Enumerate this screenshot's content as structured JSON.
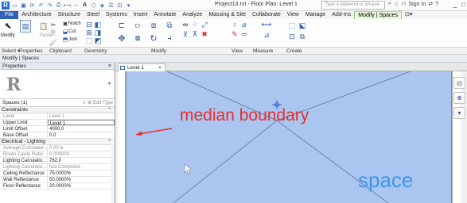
{
  "window": {
    "title": "Project13.rvt - Floor Plan: Level 1",
    "search_placeholder": "Type a keyword or phrase",
    "sign_in": "Sign In",
    "help": "?",
    "minimize": "_",
    "maximize": "□"
  },
  "ribbon_tabs": [
    "File",
    "Architecture",
    "Structure",
    "Steel",
    "Systems",
    "Insert",
    "Annotate",
    "Analyze",
    "Massing & Site",
    "Collaborate",
    "View",
    "Manage",
    "Add-Ins",
    "Modify | Spaces"
  ],
  "ribbon_tab_extra": "⊡▾",
  "ribbon": {
    "modify_label": "Modify",
    "paste_label": "Paste",
    "notch_label": "Notch",
    "cut_label": "Cut",
    "join_label": "Join"
  },
  "panels": [
    "Select ▾",
    "Properties",
    "Clipboard",
    "Geometry",
    "Modify",
    "View",
    "Measure",
    "Create"
  ],
  "context_label": "Modify | Spaces",
  "properties": {
    "title": "Properties",
    "close": "×",
    "instance_label": "Spaces (1)",
    "edit_type": "Edit Type",
    "sections": [
      {
        "name": "Constraints",
        "rows": [
          {
            "k": "Level",
            "v": "Level 1",
            "dim": true
          },
          {
            "k": "Upper Limit",
            "v": "Level 1",
            "dim": false
          },
          {
            "k": "Limit Offset",
            "v": "4000.0",
            "dim": false
          },
          {
            "k": "Base Offset",
            "v": "0.0",
            "dim": false
          }
        ]
      },
      {
        "name": "Electrical - Lighting",
        "rows": [
          {
            "k": "Average Estimated ...",
            "v": "0.00 lx",
            "dim": true
          },
          {
            "k": "Room Cavity Ratio",
            "v": "0.000000",
            "dim": true
          },
          {
            "k": "Lighting Calculatio...",
            "v": "762.0",
            "dim": false
          },
          {
            "k": "Lighting Calculatio...",
            "v": "Not Computed",
            "dim": true
          },
          {
            "k": "Ceiling Reflectance",
            "v": "75.0000%",
            "dim": false
          },
          {
            "k": "Wall Reflectance",
            "v": "50.0000%",
            "dim": false
          },
          {
            "k": "Floor Reflectance",
            "v": "20.0000%",
            "dim": false
          }
        ]
      }
    ]
  },
  "view_tab": {
    "label": "Level 1",
    "close": "×"
  },
  "annotations": {
    "median_boundary": "median boundary",
    "space": "space"
  },
  "colors": {
    "space_fill": "#aac5f0",
    "annotation_red": "#e8302a",
    "space_text": "#3d96ea"
  }
}
